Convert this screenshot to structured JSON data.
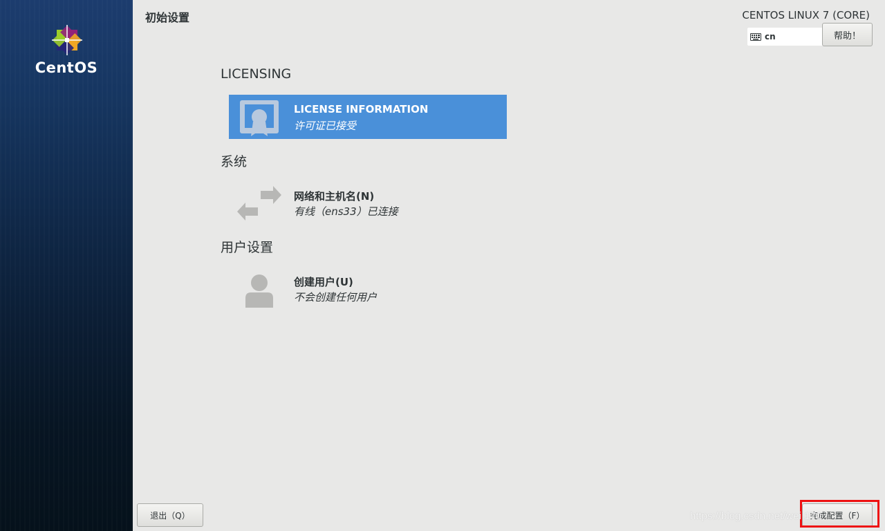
{
  "sidebar": {
    "brand": "CentOS"
  },
  "header": {
    "title": "初始设置",
    "product": "CENTOS LINUX 7 (CORE)",
    "keyboard_layout": "cn",
    "help_label": "帮助！"
  },
  "sections": [
    {
      "title": "LICENSING",
      "spokes": [
        {
          "title": "LICENSE INFORMATION",
          "status": "许可证已接受",
          "icon": "license-icon",
          "selected": true
        }
      ]
    },
    {
      "title": "系统",
      "spokes": [
        {
          "title": "网络和主机名(N)",
          "status": "有线（ens33）已连接",
          "icon": "network-arrows-icon",
          "selected": false
        }
      ]
    },
    {
      "title": "用户设置",
      "spokes": [
        {
          "title": "创建用户(U)",
          "status": "不会创建任何用户",
          "icon": "user-icon",
          "selected": false
        }
      ]
    }
  ],
  "footer": {
    "quit_label": "退出（Q）",
    "finish_label": "完成配置（F）"
  },
  "watermark": "https://blog.csdn.net/wei    170",
  "colors": {
    "selected_spoke": "#4a90d9",
    "highlight_box": "#ee1111",
    "background": "#e8e8e7"
  }
}
